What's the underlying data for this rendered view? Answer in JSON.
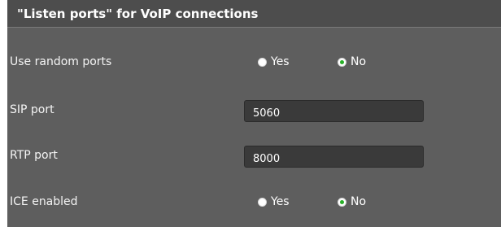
{
  "section": {
    "title": "\"Listen ports\" for VoIP connections"
  },
  "rows": {
    "random_ports": {
      "label": "Use random ports",
      "options": [
        "Yes",
        "No"
      ],
      "selected": "No"
    },
    "sip_port": {
      "label": "SIP port",
      "value": "5060"
    },
    "rtp_port": {
      "label": "RTP port",
      "value": "8000"
    },
    "ice_enabled": {
      "label": "ICE enabled",
      "options": [
        "Yes",
        "No"
      ],
      "selected": "No"
    }
  },
  "colors": {
    "panel_bg": "#5e5e5e",
    "header_bg": "#4d4d4d",
    "field_bg": "#3a3a3a",
    "radio_selected": "#27b027"
  }
}
